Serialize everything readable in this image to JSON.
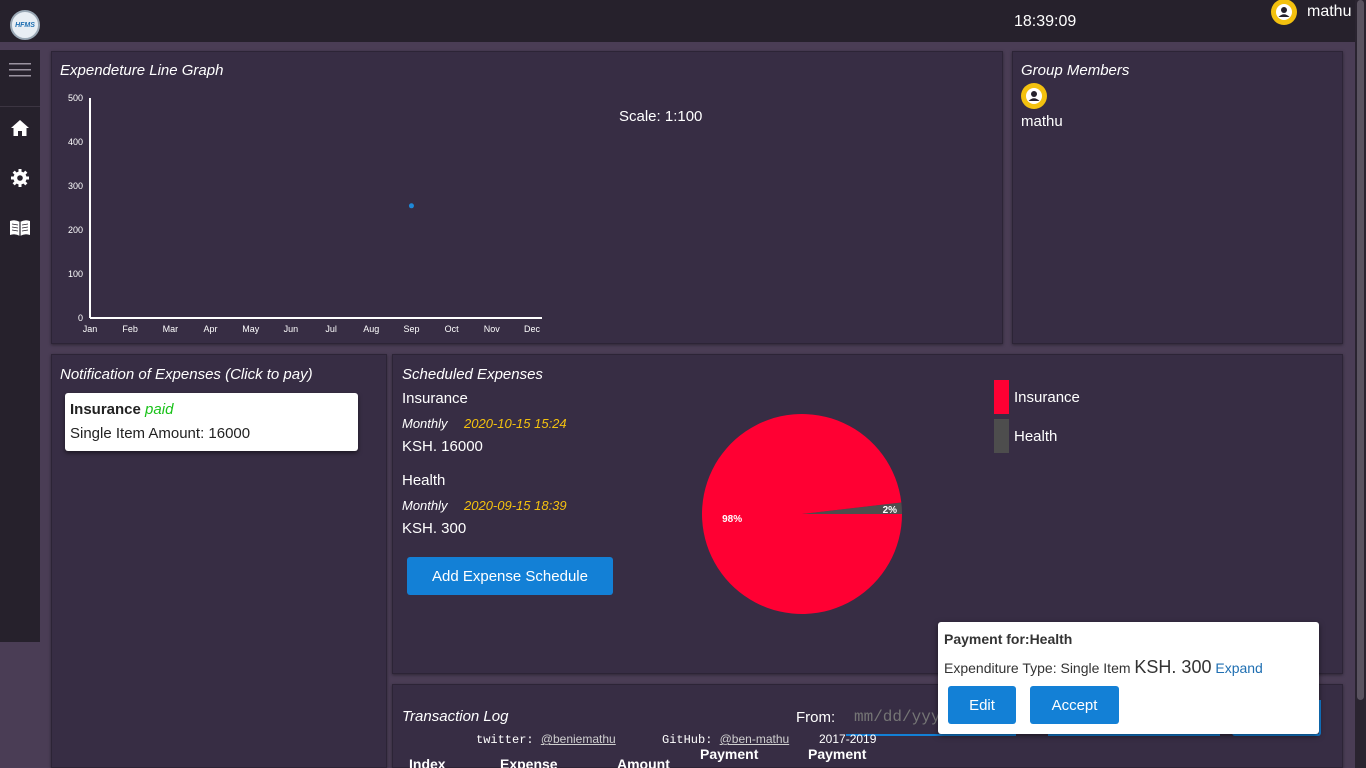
{
  "topbar": {
    "logo_text": "HFMS",
    "clock": "18:39:09",
    "username": "mathu"
  },
  "colors": {
    "background": "#4a3d55",
    "panel": "#372d44",
    "sidenav": "#26212c",
    "accent": "#1380d6",
    "avatar": "#f3c10f",
    "insurance": "#ff0033",
    "health": "#4d4d4d",
    "paid": "#19c219"
  },
  "sidenav": {
    "items": [
      {
        "icon": "hamburger-menu-icon"
      },
      {
        "icon": "home-icon"
      },
      {
        "icon": "gear-icon"
      },
      {
        "icon": "book-icon"
      }
    ]
  },
  "line_graph": {
    "title": "Expendeture Line Graph",
    "scale_label": "Scale: 1:100"
  },
  "chart_data": [
    {
      "type": "scatter",
      "title": "Expendeture Line Graph",
      "categories": [
        "Jan",
        "Feb",
        "Mar",
        "Apr",
        "May",
        "Jun",
        "Jul",
        "Aug",
        "Sep",
        "Oct",
        "Nov",
        "Dec"
      ],
      "yticks": [
        0,
        100,
        200,
        300,
        400,
        500
      ],
      "ylim": [
        0,
        500
      ],
      "series": [
        {
          "points": [
            {
              "x": "Sep",
              "y": 255
            }
          ]
        }
      ],
      "grid": false
    },
    {
      "type": "pie",
      "labels": [
        "Insurance",
        "Health"
      ],
      "values": [
        16000,
        300
      ],
      "percent_labels": [
        "98%",
        "2%"
      ],
      "legend_position": "right"
    }
  ],
  "group_members": {
    "title": "Group Members",
    "members": [
      {
        "name": "mathu"
      }
    ]
  },
  "notifications": {
    "title": "Notification of Expenses (Click to pay)",
    "items": [
      {
        "name": "Insurance",
        "status": "paid",
        "detail": "Single Item Amount: 16000"
      }
    ]
  },
  "scheduled": {
    "title": "Scheduled Expenses",
    "items": [
      {
        "name": "Insurance",
        "frequency": "Monthly",
        "date": "2020-10-15 15:24",
        "amount": "KSH. 16000"
      },
      {
        "name": "Health",
        "frequency": "Monthly",
        "date": "2020-09-15 18:39",
        "amount": "KSH. 300"
      }
    ],
    "add_button": "Add Expense Schedule",
    "legend": [
      "Insurance",
      "Health"
    ]
  },
  "popup": {
    "title": "Payment for:Health",
    "type_text": "Expenditure Type: Single Item",
    "amount": "KSH. 300",
    "expand": "Expand",
    "edit": "Edit",
    "accept": "Accept"
  },
  "transactions": {
    "title": "Transaction Log",
    "from_label": "From:",
    "date_placeholder": "mm/dd/yyyy",
    "headers": [
      "Index",
      "Expense",
      "Amount",
      "Payment",
      "Payment"
    ]
  },
  "footer": {
    "twitter_label": "twitter:",
    "twitter_handle": "@beniemathu",
    "github_label": "GitHub:",
    "github_handle": "@ben-mathu",
    "years": "2017-2019"
  }
}
